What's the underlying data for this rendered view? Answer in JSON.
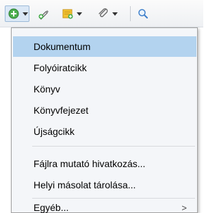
{
  "toolbar": {
    "buttons": [
      {
        "icon": "add-icon",
        "has_dropdown": true,
        "active": true
      },
      {
        "icon": "pen-add-icon",
        "has_dropdown": false
      },
      {
        "icon": "note-add-icon",
        "has_dropdown": true
      },
      {
        "icon": "paperclip-icon",
        "has_dropdown": true
      },
      {
        "icon": "search-icon",
        "has_dropdown": false
      }
    ],
    "colors": {
      "add_green": "#4caf50",
      "note_yellow": "#f2c230",
      "accent_blue": "#3e7fcb"
    }
  },
  "menu": {
    "items": [
      {
        "label": "Dokumentum",
        "selected": true
      },
      {
        "label": "Folyóiratcikk"
      },
      {
        "label": "Könyv"
      },
      {
        "label": "Könyvfejezet"
      },
      {
        "label": "Újságcikk"
      },
      {
        "label": "Fájlra mutató hivatkozás..."
      },
      {
        "label": "Helyi másolat tárolása..."
      },
      {
        "label": "Egyéb...",
        "submenu_arrow": ">"
      }
    ],
    "selected_color": "#b3d3ef"
  }
}
